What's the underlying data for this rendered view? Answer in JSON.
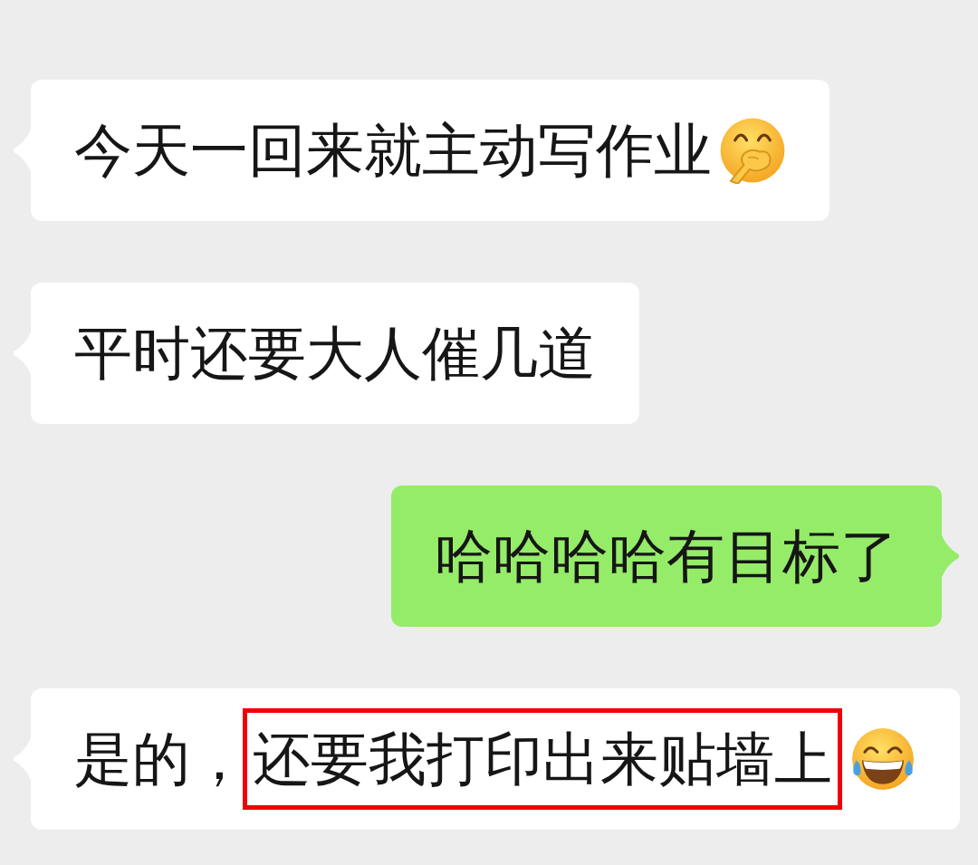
{
  "messages": [
    {
      "outgoing": false,
      "parts": [
        {
          "kind": "text",
          "text": "今天一回来就主动写作业",
          "highlighted": false
        },
        {
          "kind": "giggle"
        }
      ]
    },
    {
      "outgoing": false,
      "parts": [
        {
          "kind": "text",
          "text": "平时还要大人催几道",
          "highlighted": false
        }
      ]
    },
    {
      "outgoing": true,
      "parts": [
        {
          "kind": "text",
          "text": "哈哈哈哈有目标了",
          "highlighted": false
        }
      ]
    },
    {
      "outgoing": false,
      "parts": [
        {
          "kind": "text",
          "text": "是的，",
          "highlighted": false
        },
        {
          "kind": "text",
          "text": "还要我打印出来贴墙上",
          "highlighted": true
        },
        {
          "kind": "laugh"
        }
      ]
    }
  ]
}
